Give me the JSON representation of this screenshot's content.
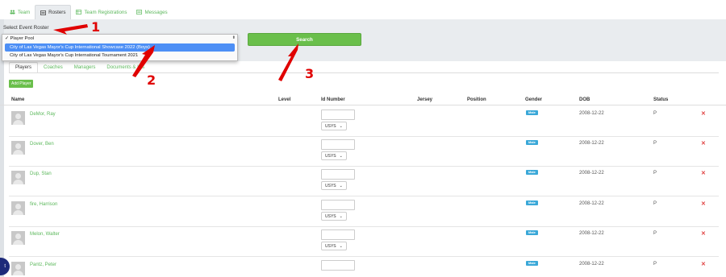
{
  "nav": {
    "tabs": [
      {
        "label": "Team",
        "icon": "users-icon"
      },
      {
        "label": "Rosters",
        "icon": "list-icon"
      },
      {
        "label": "Team Registrations",
        "icon": "table-icon"
      },
      {
        "label": "Messages",
        "icon": "messages-icon"
      }
    ]
  },
  "roster": {
    "select_label": "Select Event Roster",
    "options": [
      "✓ Player Pool",
      "City of Las Vegas Mayor's Cup International Showcase 2022 (Boys)",
      "City of Las Vegas Mayor's Cup International Tournament 2021"
    ],
    "search_label": "Search"
  },
  "subtabs": [
    "Players",
    "Coaches",
    "Managers",
    "Documents & IDs"
  ],
  "add_player_label": "Add Player",
  "table": {
    "headers": [
      "Name",
      "Level",
      "Id Number",
      "Jersey",
      "Position",
      "Gender",
      "DOB",
      "Status"
    ],
    "rows": [
      {
        "name": "DeMor, Ray",
        "org": "USYS",
        "gender": "Male",
        "dob": "2008-12-22",
        "status": "P"
      },
      {
        "name": "Dover, Ben",
        "org": "USYS",
        "gender": "Male",
        "dob": "2008-12-22",
        "status": "P"
      },
      {
        "name": "Dup, Stan",
        "org": "USYS",
        "gender": "Male",
        "dob": "2008-12-22",
        "status": "P"
      },
      {
        "name": "fire, Harrison",
        "org": "USYS",
        "gender": "Male",
        "dob": "2008-12-22",
        "status": "P"
      },
      {
        "name": "Melon, Walter",
        "org": "USYS",
        "gender": "Male",
        "dob": "2008-12-22",
        "status": "P"
      },
      {
        "name": "Pantz, Peter",
        "org": "USYS",
        "gender": "Male",
        "dob": "2008-12-22",
        "status": "P"
      }
    ]
  },
  "annotations": [
    "1",
    "2",
    "3"
  ],
  "colors": {
    "accent": "#6abf4b",
    "link": "#5cb85c",
    "badge": "#3aa8d8",
    "danger": "#e04040",
    "annotation": "#e00000"
  }
}
